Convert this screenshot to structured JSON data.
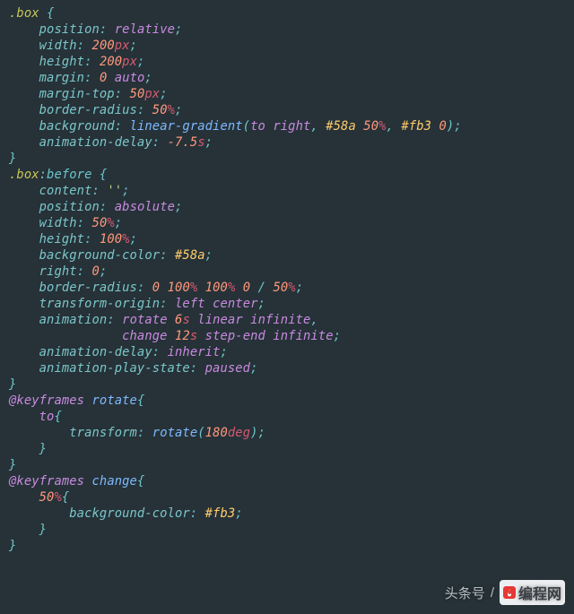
{
  "rules": [
    {
      "selector": ".box",
      "decls": [
        {
          "prop": "position",
          "tokens": [
            {
              "t": "kw",
              "v": "relative"
            }
          ]
        },
        {
          "prop": "width",
          "tokens": [
            {
              "t": "num",
              "v": "200"
            },
            {
              "t": "unit",
              "v": "px"
            }
          ]
        },
        {
          "prop": "height",
          "tokens": [
            {
              "t": "num",
              "v": "200"
            },
            {
              "t": "unit",
              "v": "px"
            }
          ]
        },
        {
          "prop": "margin",
          "tokens": [
            {
              "t": "num",
              "v": "0"
            },
            {
              "t": "sp",
              "v": " "
            },
            {
              "t": "kw",
              "v": "auto"
            }
          ]
        },
        {
          "prop": "margin-top",
          "tokens": [
            {
              "t": "num",
              "v": "50"
            },
            {
              "t": "unit",
              "v": "px"
            }
          ]
        },
        {
          "prop": "border-radius",
          "tokens": [
            {
              "t": "num",
              "v": "50"
            },
            {
              "t": "pct",
              "v": "%"
            }
          ]
        },
        {
          "prop": "background",
          "tokens": [
            {
              "t": "fn",
              "v": "linear-gradient"
            },
            {
              "t": "punc",
              "v": "("
            },
            {
              "t": "to",
              "v": "to"
            },
            {
              "t": "sp",
              "v": " "
            },
            {
              "t": "kw",
              "v": "right"
            },
            {
              "t": "punc",
              "v": ","
            },
            {
              "t": "sp",
              "v": " "
            },
            {
              "t": "col",
              "v": "#58a"
            },
            {
              "t": "sp",
              "v": " "
            },
            {
              "t": "num",
              "v": "50"
            },
            {
              "t": "pct",
              "v": "%"
            },
            {
              "t": "punc",
              "v": ","
            },
            {
              "t": "sp",
              "v": " "
            },
            {
              "t": "col",
              "v": "#fb3"
            },
            {
              "t": "sp",
              "v": " "
            },
            {
              "t": "num",
              "v": "0"
            },
            {
              "t": "punc",
              "v": ")"
            }
          ]
        },
        {
          "prop": "animation-delay",
          "tokens": [
            {
              "t": "num",
              "v": "-7.5"
            },
            {
              "t": "unit",
              "v": "s"
            }
          ]
        }
      ]
    },
    {
      "selector": ".box",
      "pseudo": ":before",
      "decls": [
        {
          "prop": "content",
          "tokens": [
            {
              "t": "str",
              "v": "''"
            }
          ]
        },
        {
          "prop": "position",
          "tokens": [
            {
              "t": "kw",
              "v": "absolute"
            }
          ]
        },
        {
          "prop": "width",
          "tokens": [
            {
              "t": "num",
              "v": "50"
            },
            {
              "t": "pct",
              "v": "%"
            }
          ]
        },
        {
          "prop": "height",
          "tokens": [
            {
              "t": "num",
              "v": "100"
            },
            {
              "t": "pct",
              "v": "%"
            }
          ]
        },
        {
          "prop": "background-color",
          "tokens": [
            {
              "t": "col",
              "v": "#58a"
            }
          ]
        },
        {
          "prop": "right",
          "tokens": [
            {
              "t": "num",
              "v": "0"
            }
          ]
        },
        {
          "prop": "border-radius",
          "tokens": [
            {
              "t": "num",
              "v": "0"
            },
            {
              "t": "sp",
              "v": " "
            },
            {
              "t": "num",
              "v": "100"
            },
            {
              "t": "pct",
              "v": "%"
            },
            {
              "t": "sp",
              "v": " "
            },
            {
              "t": "num",
              "v": "100"
            },
            {
              "t": "pct",
              "v": "%"
            },
            {
              "t": "sp",
              "v": " "
            },
            {
              "t": "num",
              "v": "0"
            },
            {
              "t": "sp",
              "v": " "
            },
            {
              "t": "slash",
              "v": "/"
            },
            {
              "t": "sp",
              "v": " "
            },
            {
              "t": "num",
              "v": "50"
            },
            {
              "t": "pct",
              "v": "%"
            }
          ]
        },
        {
          "prop": "transform-origin",
          "tokens": [
            {
              "t": "kw",
              "v": "left"
            },
            {
              "t": "sp",
              "v": " "
            },
            {
              "t": "kw",
              "v": "center"
            }
          ]
        },
        {
          "prop": "animation",
          "tokens": [
            {
              "t": "kw",
              "v": "rotate"
            },
            {
              "t": "sp",
              "v": " "
            },
            {
              "t": "num",
              "v": "6"
            },
            {
              "t": "unit",
              "v": "s"
            },
            {
              "t": "sp",
              "v": " "
            },
            {
              "t": "kw",
              "v": "linear"
            },
            {
              "t": "sp",
              "v": " "
            },
            {
              "t": "kw",
              "v": "infinite"
            }
          ],
          "continued": [
            {
              "t": "kw",
              "v": "change"
            },
            {
              "t": "sp",
              "v": " "
            },
            {
              "t": "num",
              "v": "12"
            },
            {
              "t": "unit",
              "v": "s"
            },
            {
              "t": "sp",
              "v": " "
            },
            {
              "t": "kw",
              "v": "step-end"
            },
            {
              "t": "sp",
              "v": " "
            },
            {
              "t": "kw",
              "v": "infinite"
            }
          ]
        },
        {
          "prop": "animation-delay",
          "tokens": [
            {
              "t": "kw",
              "v": "inherit"
            }
          ]
        },
        {
          "prop": "animation-play-state",
          "tokens": [
            {
              "t": "kw",
              "v": "paused"
            }
          ]
        }
      ]
    }
  ],
  "keyframes": [
    {
      "name": "rotate",
      "blocks": [
        {
          "key": "to",
          "decls": [
            {
              "prop": "transform",
              "tokens": [
                {
                  "t": "fn",
                  "v": "rotate"
                },
                {
                  "t": "punc",
                  "v": "("
                },
                {
                  "t": "num",
                  "v": "180"
                },
                {
                  "t": "unit",
                  "v": "deg"
                },
                {
                  "t": "punc",
                  "v": ")"
                }
              ]
            }
          ]
        }
      ]
    },
    {
      "name": "change",
      "blocks": [
        {
          "key": "50",
          "keyUnit": "%",
          "decls": [
            {
              "prop": "background-color",
              "tokens": [
                {
                  "t": "col",
                  "v": "#fb3"
                }
              ]
            }
          ]
        }
      ]
    }
  ],
  "watermark": {
    "source": "头条号",
    "slash": "/",
    "brand": "编程网"
  }
}
